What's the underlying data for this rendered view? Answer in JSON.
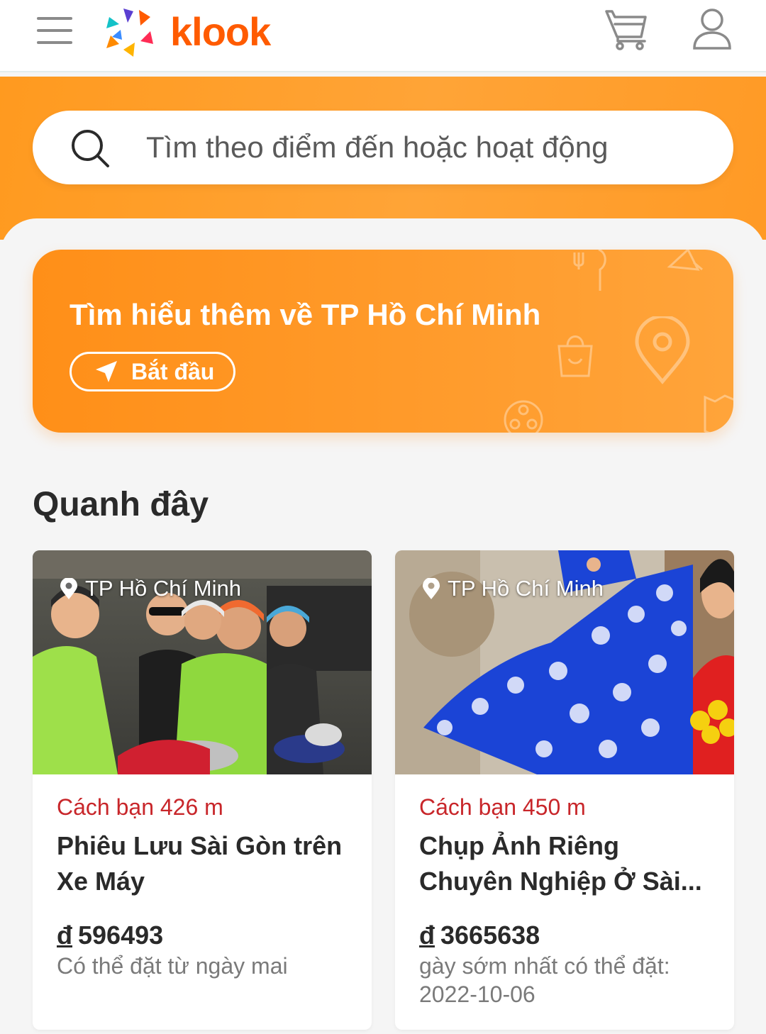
{
  "header": {
    "logo_text": "klook",
    "menu_icon": "hamburger-menu-icon",
    "cart_icon": "shopping-cart-icon",
    "user_icon": "user-account-icon"
  },
  "search": {
    "placeholder": "Tìm theo điểm đến hoặc hoạt động",
    "icon": "search-icon"
  },
  "promo": {
    "title": "Tìm hiểu thêm về TP Hồ Chí Minh",
    "button_label": "Bắt đầu",
    "button_icon": "navigation-arrow-icon"
  },
  "nearby": {
    "section_title": "Quanh đây",
    "cards": [
      {
        "location": "TP Hồ Chí Minh",
        "distance": "Cách bạn 426 m",
        "title": "Phiêu Lưu Sài Gòn trên Xe Máy",
        "currency": "đ",
        "price": "596493",
        "availability": "Có thể đặt từ ngày mai"
      },
      {
        "location": "TP Hồ Chí Minh",
        "distance": "Cách bạn 450 m",
        "title": "Chụp Ảnh Riêng Chuyên Nghiệp Ở Sài...",
        "currency": "đ",
        "price": "3665638",
        "availability": "gày sớm nhất có thể đặt: 2022-10-06"
      }
    ]
  },
  "colors": {
    "brand": "#ff5b00",
    "band": "#ffa032",
    "distance": "#c8262a"
  }
}
